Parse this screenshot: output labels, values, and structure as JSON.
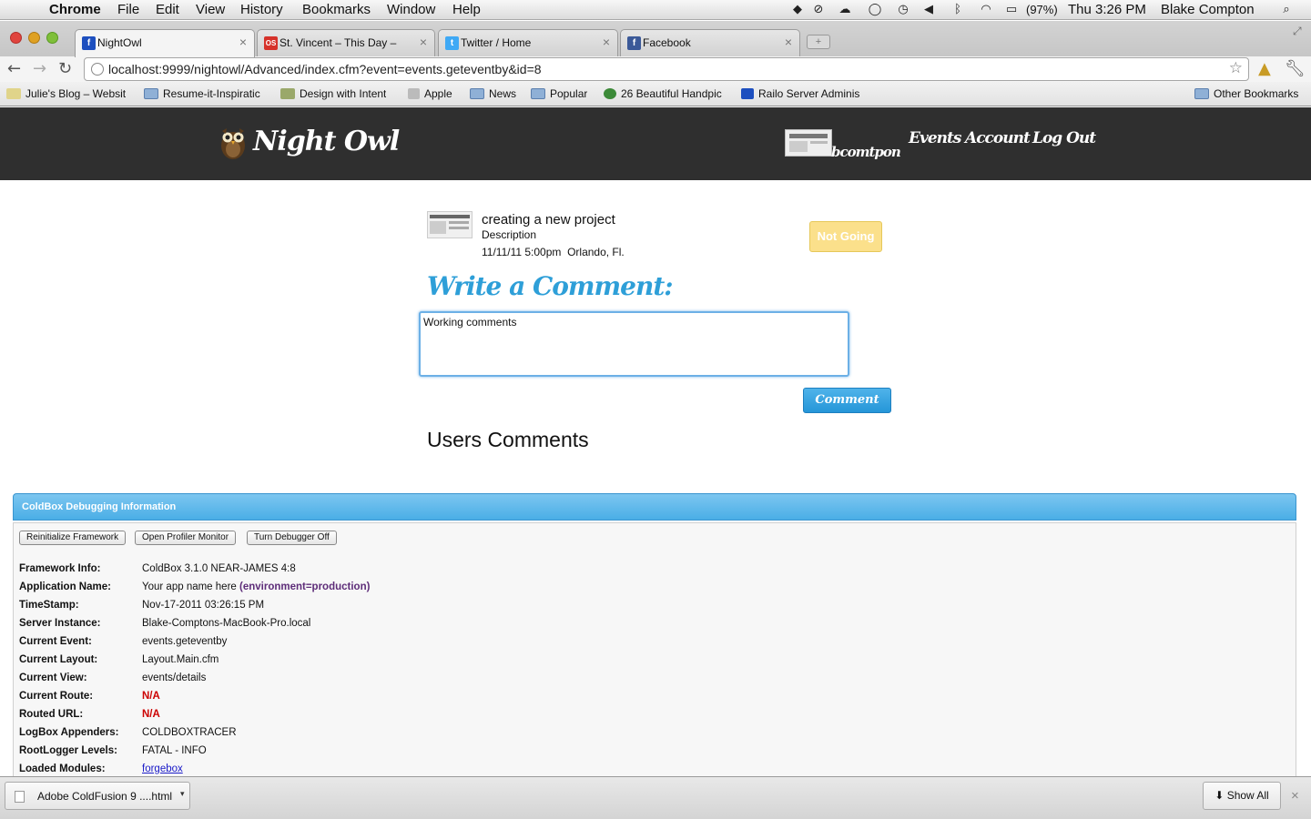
{
  "menubar": {
    "app_name": "Chrome",
    "items": [
      "File",
      "Edit",
      "View",
      "History",
      "Bookmarks",
      "Window",
      "Help"
    ],
    "battery": "(97%)",
    "clock": "Thu 3:26 PM",
    "user": "Blake Compton"
  },
  "tabs": [
    {
      "title": "NightOwl",
      "favicon_color": "#1d4fbf",
      "active": true
    },
    {
      "title": "St. Vincent – This Day – Last",
      "favicon_color": "#d6322a",
      "active": false
    },
    {
      "title": "Twitter / Home",
      "favicon_color": "#3fa9f5",
      "active": false
    },
    {
      "title": "Facebook",
      "favicon_color": "#3b5998",
      "active": false
    }
  ],
  "toolbar": {
    "url": "localhost:9999/nightowl/Advanced/index.cfm?event=events.geteventby&id=8"
  },
  "bookmarks": {
    "items": [
      "Julie's Blog – Websit",
      "Resume-it-Inspiratic",
      "Design with Intent",
      "Apple",
      "News",
      "Popular",
      "26 Beautiful Handpic",
      "Railo Server Adminis"
    ],
    "other": "Other Bookmarks"
  },
  "site": {
    "logo": "Night Owl",
    "username": "bcomtpon",
    "nav": [
      "Events",
      "Account",
      "Log Out"
    ]
  },
  "event": {
    "title": "creating a new project",
    "description": "Description",
    "when": "11/11/11 5:00pm  Orlando, Fl.",
    "rsvp_label": "Not Going"
  },
  "comment_form": {
    "heading": "Write a Comment:",
    "value": "Working comments",
    "submit_label": "Comment"
  },
  "users_comments_heading": "Users Comments",
  "debug": {
    "title": "ColdBox Debugging Information",
    "buttons": [
      "Reinitialize Framework",
      "Open Profiler Monitor",
      "Turn Debugger Off"
    ],
    "rows": [
      {
        "key": "Framework Info:",
        "value": "ColdBox 3.1.0 NEAR-JAMES 4:8"
      },
      {
        "key": "Application Name:",
        "value": "Your app name here",
        "extra": "(environment=production)"
      },
      {
        "key": "TimeStamp:",
        "value": "Nov-17-2011 03:26:15 PM"
      },
      {
        "key": "Server Instance:",
        "value": "Blake-Comptons-MacBook-Pro.local"
      },
      {
        "key": "Current Event:",
        "value": "events.geteventby"
      },
      {
        "key": "Current Layout:",
        "value": "Layout.Main.cfm"
      },
      {
        "key": "Current View:",
        "value": "events/details"
      },
      {
        "key": "Current Route:",
        "value": "N/A"
      },
      {
        "key": "Routed URL:",
        "value": "N/A"
      },
      {
        "key": "LogBox Appenders:",
        "value": "COLDBOXTRACER"
      },
      {
        "key": "RootLogger Levels:",
        "value": "FATAL - INFO"
      },
      {
        "key": "Loaded Modules:",
        "value": "forgebox"
      }
    ]
  },
  "downloads": {
    "item": "Adobe ColdFusion 9 ....html",
    "show_all": "Show All"
  }
}
